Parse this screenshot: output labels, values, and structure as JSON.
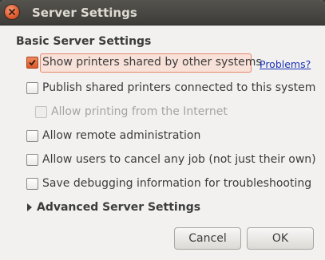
{
  "window": {
    "title": "Server Settings",
    "close_icon": "close-icon"
  },
  "section": {
    "title": "Basic Server Settings"
  },
  "options": [
    {
      "label": "Show printers shared by other systems",
      "checked": true,
      "enabled": true
    },
    {
      "label": "Publish shared printers connected to this system",
      "checked": false,
      "enabled": true
    },
    {
      "label": "Allow printing from the Internet",
      "checked": false,
      "enabled": false
    },
    {
      "label": "Allow remote administration",
      "checked": false,
      "enabled": true
    },
    {
      "label": "Allow users to cancel any job (not just their own)",
      "checked": false,
      "enabled": true
    },
    {
      "label": "Save debugging information for troubleshooting",
      "checked": false,
      "enabled": true
    }
  ],
  "problems_link": "Problems?",
  "advanced": {
    "label": "Advanced Server Settings",
    "expanded": false
  },
  "buttons": {
    "cancel": "Cancel",
    "ok": "OK"
  },
  "colors": {
    "accent": "#e05a2b",
    "titlebar": "#3c3b37",
    "link": "#1b33b8"
  }
}
